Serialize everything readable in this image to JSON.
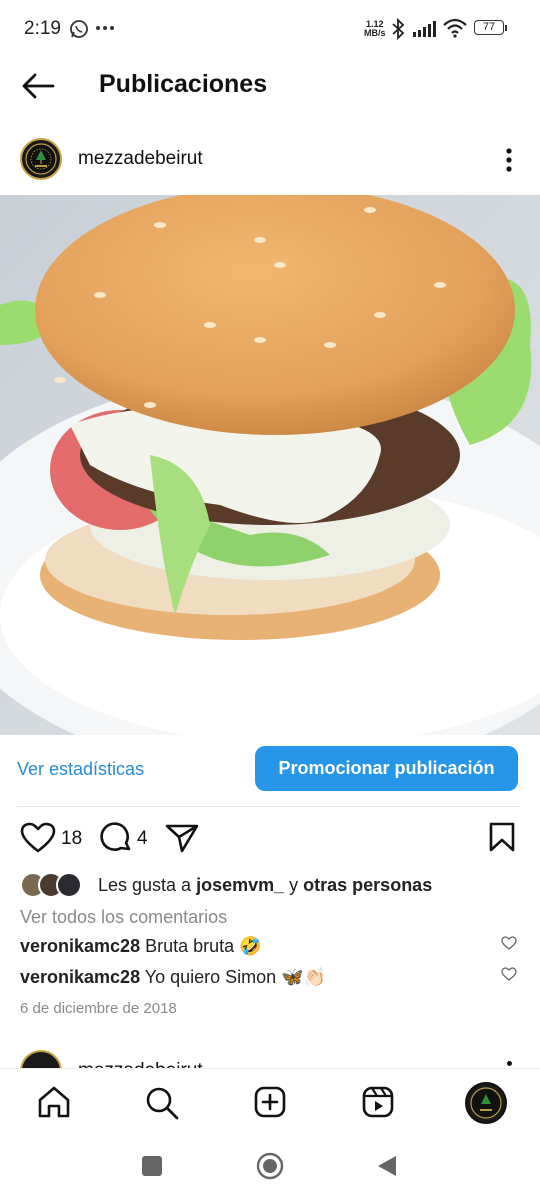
{
  "status_bar": {
    "time": "2:19",
    "net_speed_value": "1.12",
    "net_speed_unit": "MB/s",
    "battery": "77",
    "icons": [
      "whatsapp-icon",
      "more-dots-icon",
      "bluetooth-icon",
      "signal-icon",
      "wifi-icon",
      "battery-icon"
    ]
  },
  "header": {
    "title": "Publicaciones",
    "back_icon": "back-arrow-icon"
  },
  "post": {
    "username": "mezzadebeirut",
    "options_icon": "more-vertical-icon",
    "photo_subject": "hamburger-photo",
    "insights_label": "Ver estadísticas",
    "promote_label": "Promocionar publicación",
    "likes_count": "18",
    "comments_count": "4",
    "likes_prefix": "Les gusta a ",
    "likes_user": "josemvm_",
    "likes_mid": " y ",
    "likes_others": "otras personas",
    "view_comments_label": "Ver todos los comentarios",
    "comments": [
      {
        "user": "veronikamc28",
        "text": " Bruta bruta 🤣"
      },
      {
        "user": "veronikamc28",
        "text": " Yo quiero Simon 🦋👏🏻"
      }
    ],
    "date": "6 de diciembre de 2018"
  },
  "next_post": {
    "username": "mezzadebeirut"
  },
  "bottom_nav": {
    "items": [
      "home-icon",
      "search-icon",
      "create-icon",
      "reels-icon",
      "profile-avatar"
    ]
  },
  "system_nav": {
    "items": [
      "recents-square-icon",
      "home-circle-icon",
      "back-triangle-icon"
    ]
  },
  "colors": {
    "link_blue": "#2a8ad6",
    "button_blue": "#2796e8",
    "muted_text": "#8a8a8a"
  }
}
